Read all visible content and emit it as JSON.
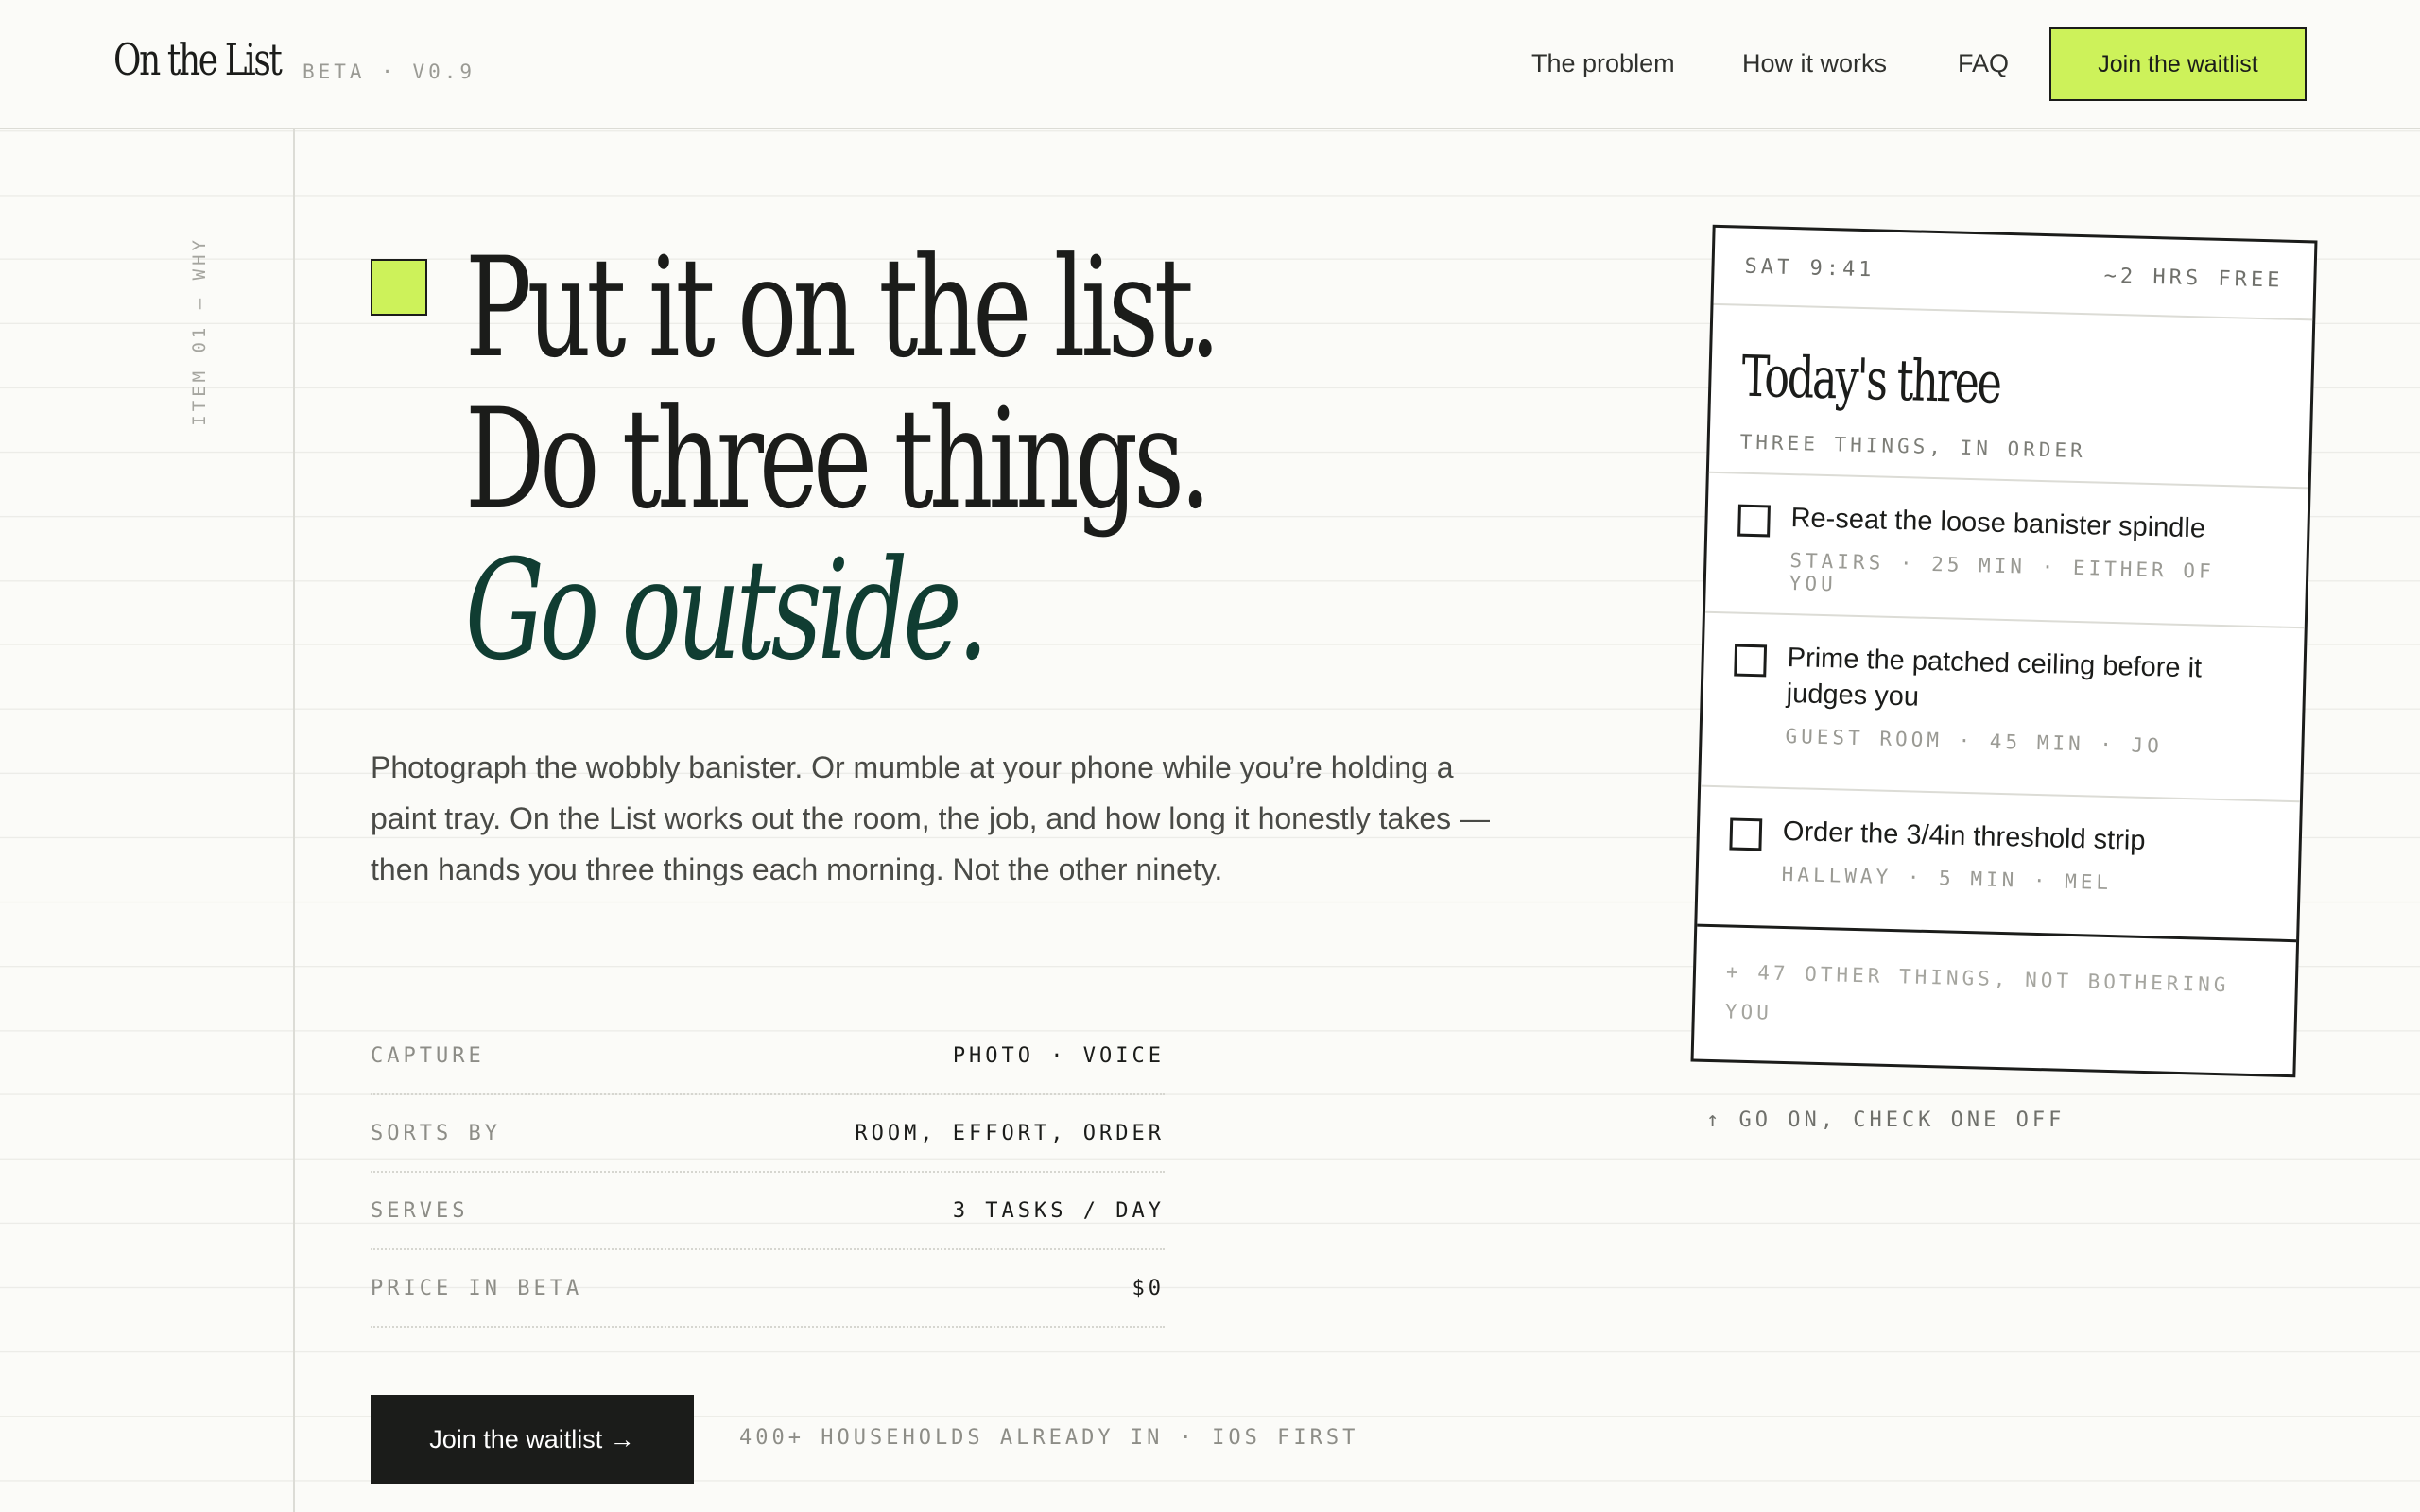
{
  "header": {
    "logo": "On the List",
    "version": "BETA · V0.9",
    "nav": [
      "The problem",
      "How it works",
      "FAQ"
    ],
    "cta": "Join the waitlist"
  },
  "rail": {
    "label": "ITEM 01 — WHY"
  },
  "hero": {
    "line1": "Put it on the list.",
    "line2": "Do three things.",
    "line3": "Go outside.",
    "lede": "Photograph the wobbly banister. Or mumble at your phone while you’re holding a paint tray. On the List works out the room, the job, and how long it honestly takes — then hands you three things each morning. Not the other ninety."
  },
  "specs": [
    {
      "key": "CAPTURE",
      "value": "PHOTO · VOICE"
    },
    {
      "key": "SORTS BY",
      "value": "ROOM, EFFORT, ORDER"
    },
    {
      "key": "SERVES",
      "value": "3 TASKS / DAY"
    },
    {
      "key": "PRICE IN BETA",
      "value": "$0"
    }
  ],
  "cta": {
    "button": "Join the waitlist →",
    "note": "400+ HOUSEHOLDS ALREADY IN · IOS FIRST"
  },
  "card": {
    "time": "SAT 9:41",
    "free": "~2 HRS FREE",
    "title": "Today's three",
    "subtitle": "THREE THINGS, IN ORDER",
    "tasks": [
      {
        "title": "Re-seat the loose banister spindle",
        "meta": "STAIRS · 25 MIN · EITHER OF YOU"
      },
      {
        "title": "Prime the patched ceiling before it judges you",
        "meta": "GUEST ROOM · 45 MIN · JO"
      },
      {
        "title": "Order the 3/4in threshold strip",
        "meta": "HALLWAY · 5 MIN · MEL"
      }
    ],
    "more": "+ 47 OTHER THINGS, NOT BOTHERING YOU",
    "hint": "↑ GO ON, CHECK ONE OFF"
  },
  "colors": {
    "accent": "#cdf25a",
    "ink": "#1b1c1a",
    "green": "#103d32",
    "background": "#fbfbf8"
  }
}
